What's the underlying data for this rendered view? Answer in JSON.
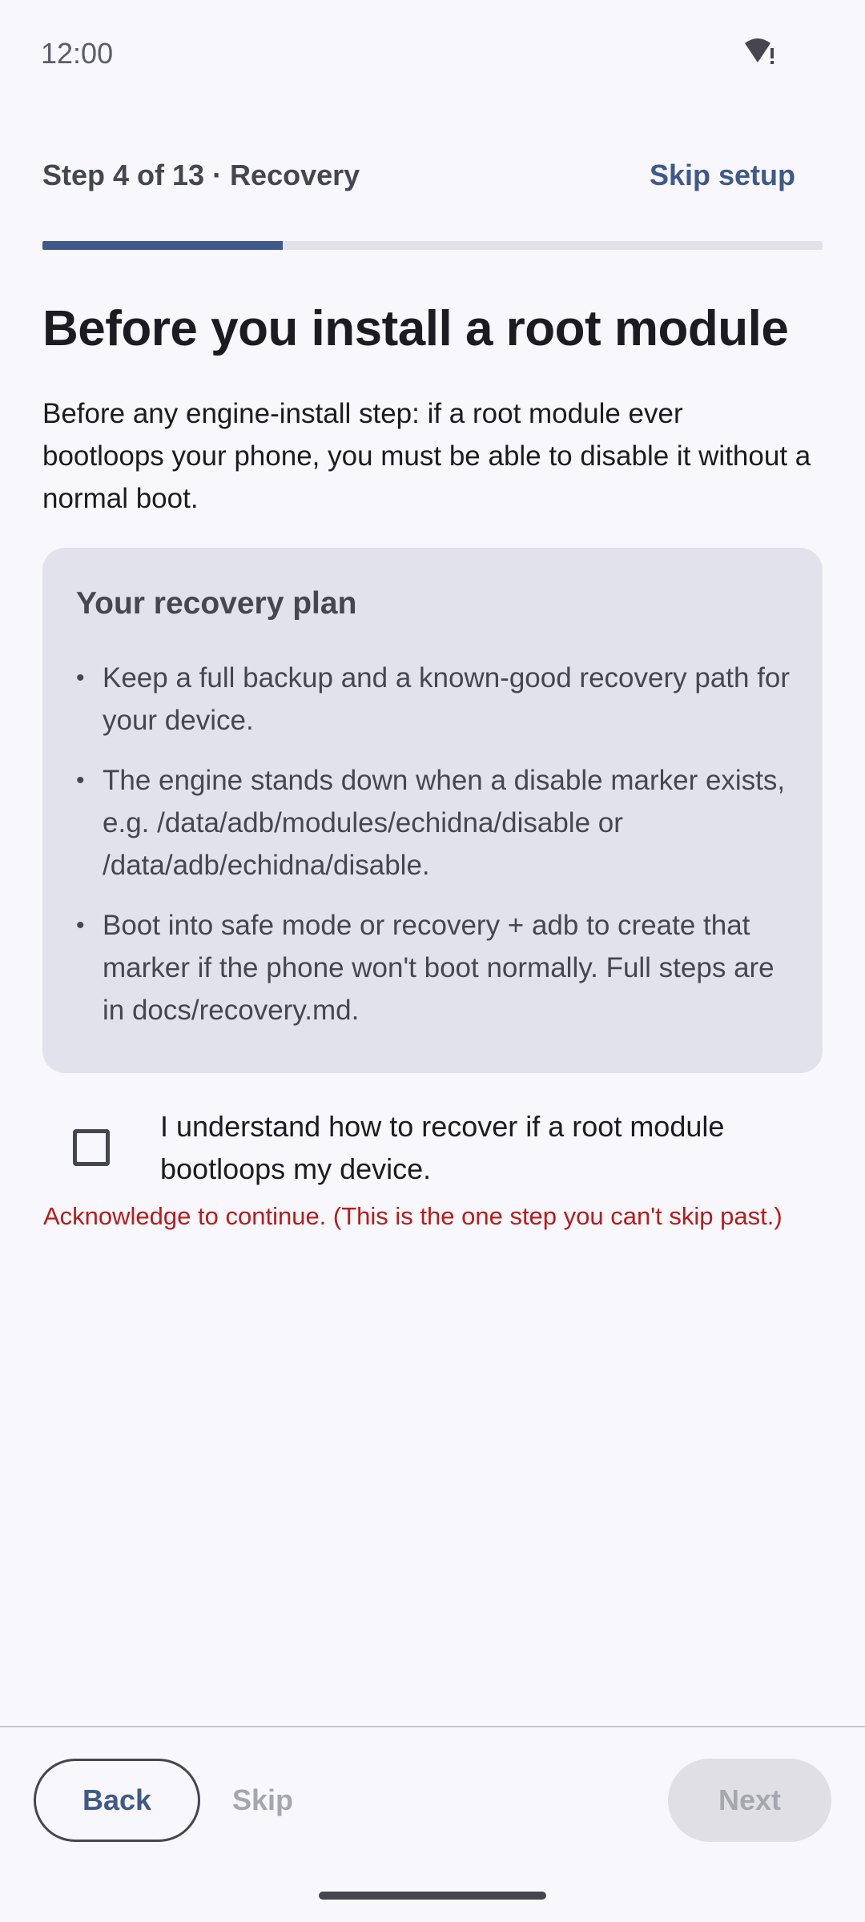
{
  "status_bar": {
    "time": "12:00",
    "icons": [
      "wifi-alert-icon"
    ]
  },
  "header": {
    "step_label": "Step 4 of 13 · Recovery",
    "skip_setup_label": "Skip setup",
    "progress_fraction": 0.308
  },
  "page": {
    "title": "Before you install a root module",
    "intro": "Before any engine-install step: if a root module ever bootloops your phone, you must be able to disable it without a normal boot."
  },
  "card": {
    "title": "Your recovery plan",
    "items": [
      "Keep a full backup and a known-good recovery path for your device.",
      "The engine stands down when a disable marker exists, e.g. /data/adb/modules/echidna/disable or /data/adb/echidna/disable.",
      "Boot into safe mode or recovery + adb to create that marker if the phone won't boot normally. Full steps are in docs/recovery.md."
    ]
  },
  "acknowledge": {
    "checked": false,
    "label": "I understand how to recover if a root module bootloops my device.",
    "error": "Acknowledge to continue. (This is the one step you can't skip past.)"
  },
  "footer": {
    "back_label": "Back",
    "skip_label": "Skip",
    "next_label": "Next"
  },
  "colors": {
    "accent": "#3f5a8a",
    "error": "#ba1a1a",
    "card_bg": "#e1e2ec"
  }
}
